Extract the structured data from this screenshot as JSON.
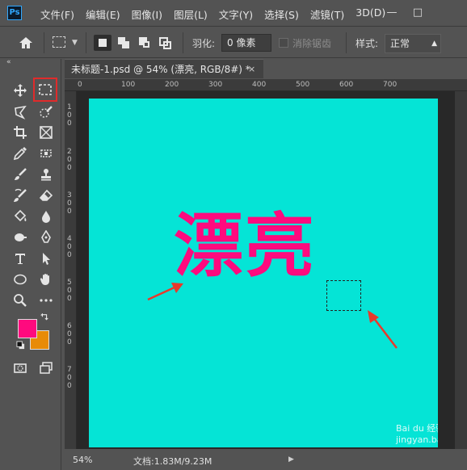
{
  "app": {
    "logo": "Ps"
  },
  "menu": [
    "文件(F)",
    "编辑(E)",
    "图像(I)",
    "图层(L)",
    "文字(Y)",
    "选择(S)",
    "滤镜(T)",
    "3D(D)"
  ],
  "window_controls": {
    "minimize": "—",
    "restore": "□"
  },
  "options": {
    "feather_label": "羽化:",
    "feather_value": "0 像素",
    "antialias_label": "消除锯齿",
    "style_label": "样式:",
    "style_value": "正常"
  },
  "tools": [
    "move-tool",
    "rectangular-marquee-tool",
    "lasso-tool",
    "quick-selection-tool",
    "crop-tool",
    "frame-tool",
    "eyedropper-tool",
    "spot-healing-tool",
    "brush-tool",
    "clone-stamp-tool",
    "history-brush-tool",
    "eraser-tool",
    "paint-bucket-tool",
    "blur-tool",
    "dodge-tool",
    "pen-tool",
    "type-tool",
    "path-selection-tool",
    "ellipse-tool",
    "hand-tool",
    "zoom-tool",
    "more-tools"
  ],
  "colors": {
    "foreground": "#ff0a7e",
    "background": "#e88b07",
    "canvas": "#05e4d6",
    "text": "#ff0a7e",
    "accent": "#e02b2b"
  },
  "tab": {
    "title": "未标题-1.psd @ 54% (漂亮, RGB/8#) *",
    "close": "×"
  },
  "ruler": {
    "top": [
      "0",
      "100",
      "200",
      "300",
      "400",
      "500",
      "600",
      "700"
    ],
    "left": [
      "1",
      "0",
      "0",
      "2",
      "0",
      "0",
      "3",
      "0",
      "0",
      "4",
      "0",
      "0",
      "5",
      "0",
      "0",
      "6",
      "0",
      "0",
      "7",
      "0",
      "0"
    ]
  },
  "canvas": {
    "text": "漂亮"
  },
  "status": {
    "zoom": "54%",
    "doc": "文档:1.83M/9.23M"
  },
  "watermark": "Bai du 经验  jingyan.baidu.com"
}
